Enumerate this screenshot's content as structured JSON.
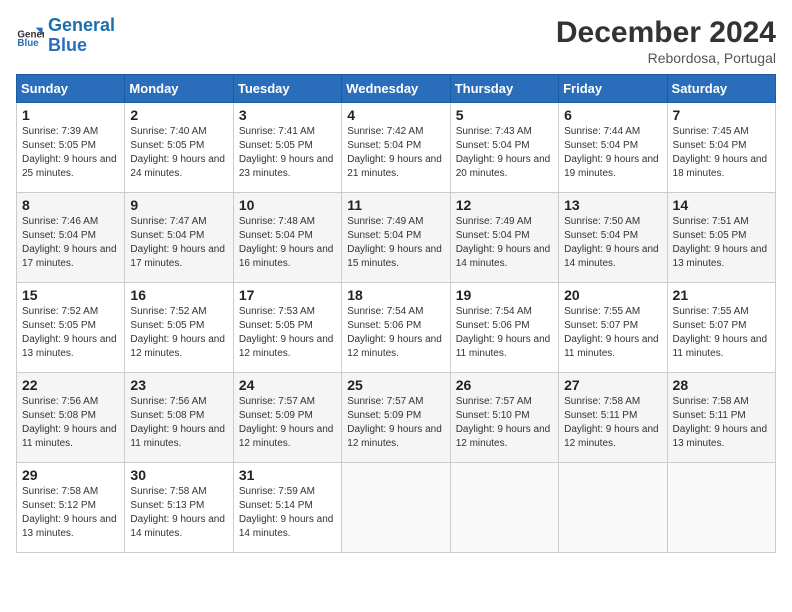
{
  "header": {
    "logo_general": "General",
    "logo_blue": "Blue",
    "month_title": "December 2024",
    "location": "Rebordosa, Portugal"
  },
  "weekdays": [
    "Sunday",
    "Monday",
    "Tuesday",
    "Wednesday",
    "Thursday",
    "Friday",
    "Saturday"
  ],
  "weeks": [
    [
      {
        "day": "1",
        "sunrise": "7:39 AM",
        "sunset": "5:05 PM",
        "daylight": "9 hours and 25 minutes."
      },
      {
        "day": "2",
        "sunrise": "7:40 AM",
        "sunset": "5:05 PM",
        "daylight": "9 hours and 24 minutes."
      },
      {
        "day": "3",
        "sunrise": "7:41 AM",
        "sunset": "5:05 PM",
        "daylight": "9 hours and 23 minutes."
      },
      {
        "day": "4",
        "sunrise": "7:42 AM",
        "sunset": "5:04 PM",
        "daylight": "9 hours and 21 minutes."
      },
      {
        "day": "5",
        "sunrise": "7:43 AM",
        "sunset": "5:04 PM",
        "daylight": "9 hours and 20 minutes."
      },
      {
        "day": "6",
        "sunrise": "7:44 AM",
        "sunset": "5:04 PM",
        "daylight": "9 hours and 19 minutes."
      },
      {
        "day": "7",
        "sunrise": "7:45 AM",
        "sunset": "5:04 PM",
        "daylight": "9 hours and 18 minutes."
      }
    ],
    [
      {
        "day": "8",
        "sunrise": "7:46 AM",
        "sunset": "5:04 PM",
        "daylight": "9 hours and 17 minutes."
      },
      {
        "day": "9",
        "sunrise": "7:47 AM",
        "sunset": "5:04 PM",
        "daylight": "9 hours and 17 minutes."
      },
      {
        "day": "10",
        "sunrise": "7:48 AM",
        "sunset": "5:04 PM",
        "daylight": "9 hours and 16 minutes."
      },
      {
        "day": "11",
        "sunrise": "7:49 AM",
        "sunset": "5:04 PM",
        "daylight": "9 hours and 15 minutes."
      },
      {
        "day": "12",
        "sunrise": "7:49 AM",
        "sunset": "5:04 PM",
        "daylight": "9 hours and 14 minutes."
      },
      {
        "day": "13",
        "sunrise": "7:50 AM",
        "sunset": "5:04 PM",
        "daylight": "9 hours and 14 minutes."
      },
      {
        "day": "14",
        "sunrise": "7:51 AM",
        "sunset": "5:05 PM",
        "daylight": "9 hours and 13 minutes."
      }
    ],
    [
      {
        "day": "15",
        "sunrise": "7:52 AM",
        "sunset": "5:05 PM",
        "daylight": "9 hours and 13 minutes."
      },
      {
        "day": "16",
        "sunrise": "7:52 AM",
        "sunset": "5:05 PM",
        "daylight": "9 hours and 12 minutes."
      },
      {
        "day": "17",
        "sunrise": "7:53 AM",
        "sunset": "5:05 PM",
        "daylight": "9 hours and 12 minutes."
      },
      {
        "day": "18",
        "sunrise": "7:54 AM",
        "sunset": "5:06 PM",
        "daylight": "9 hours and 12 minutes."
      },
      {
        "day": "19",
        "sunrise": "7:54 AM",
        "sunset": "5:06 PM",
        "daylight": "9 hours and 11 minutes."
      },
      {
        "day": "20",
        "sunrise": "7:55 AM",
        "sunset": "5:07 PM",
        "daylight": "9 hours and 11 minutes."
      },
      {
        "day": "21",
        "sunrise": "7:55 AM",
        "sunset": "5:07 PM",
        "daylight": "9 hours and 11 minutes."
      }
    ],
    [
      {
        "day": "22",
        "sunrise": "7:56 AM",
        "sunset": "5:08 PM",
        "daylight": "9 hours and 11 minutes."
      },
      {
        "day": "23",
        "sunrise": "7:56 AM",
        "sunset": "5:08 PM",
        "daylight": "9 hours and 11 minutes."
      },
      {
        "day": "24",
        "sunrise": "7:57 AM",
        "sunset": "5:09 PM",
        "daylight": "9 hours and 12 minutes."
      },
      {
        "day": "25",
        "sunrise": "7:57 AM",
        "sunset": "5:09 PM",
        "daylight": "9 hours and 12 minutes."
      },
      {
        "day": "26",
        "sunrise": "7:57 AM",
        "sunset": "5:10 PM",
        "daylight": "9 hours and 12 minutes."
      },
      {
        "day": "27",
        "sunrise": "7:58 AM",
        "sunset": "5:11 PM",
        "daylight": "9 hours and 12 minutes."
      },
      {
        "day": "28",
        "sunrise": "7:58 AM",
        "sunset": "5:11 PM",
        "daylight": "9 hours and 13 minutes."
      }
    ],
    [
      {
        "day": "29",
        "sunrise": "7:58 AM",
        "sunset": "5:12 PM",
        "daylight": "9 hours and 13 minutes."
      },
      {
        "day": "30",
        "sunrise": "7:58 AM",
        "sunset": "5:13 PM",
        "daylight": "9 hours and 14 minutes."
      },
      {
        "day": "31",
        "sunrise": "7:59 AM",
        "sunset": "5:14 PM",
        "daylight": "9 hours and 14 minutes."
      },
      null,
      null,
      null,
      null
    ]
  ]
}
